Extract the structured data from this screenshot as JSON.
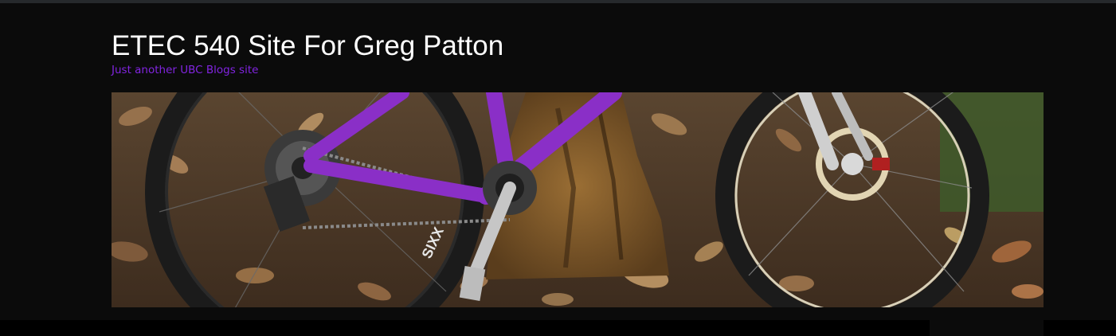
{
  "site": {
    "title": "ETEC 540 Site For Greg Patton",
    "tagline": "Just another UBC Blogs site"
  },
  "header_image": {
    "subject": "purple mountain bike leaning against a tree stump on autumn leaves",
    "tire_brand_text": "SIXX"
  },
  "colors": {
    "background": "#0b0b0b",
    "title": "#ffffff",
    "tagline": "#8124e0",
    "top_strip": "#26292c",
    "nav_bar": "#000000"
  }
}
